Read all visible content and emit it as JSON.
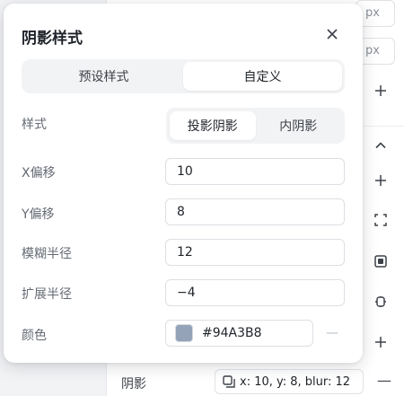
{
  "popover": {
    "title": "阴影样式",
    "tabs": [
      {
        "label": "预设样式",
        "active": false
      },
      {
        "label": "自定义",
        "active": true
      }
    ],
    "style_row": {
      "label": "样式",
      "options": [
        {
          "label": "投影阴影",
          "active": true
        },
        {
          "label": "内阴影",
          "active": false
        }
      ]
    },
    "x_offset": {
      "label": "X偏移",
      "value": "10"
    },
    "y_offset": {
      "label": "Y偏移",
      "value": "8"
    },
    "blur": {
      "label": "模糊半径",
      "value": "12"
    },
    "spread": {
      "label": "扩展半径",
      "value": "−4"
    },
    "color": {
      "label": "颜色",
      "hex": "#94A3B8",
      "minus": "—"
    }
  },
  "background": {
    "px_unit_1": "px",
    "px_unit_2": "px",
    "shadow_label": "阴影",
    "shadow_summary": "x: 10, y: 8, blur: 12",
    "minus": "—"
  },
  "icons": [
    "close-icon",
    "plus-icon",
    "chevron-up-icon",
    "expand-corners-icon",
    "frame-icon",
    "component-icon",
    "shadow-icon",
    "minus-icon"
  ],
  "colors": {
    "swatch": "#94A3B8",
    "accent_bg": "#f2f3f5"
  }
}
